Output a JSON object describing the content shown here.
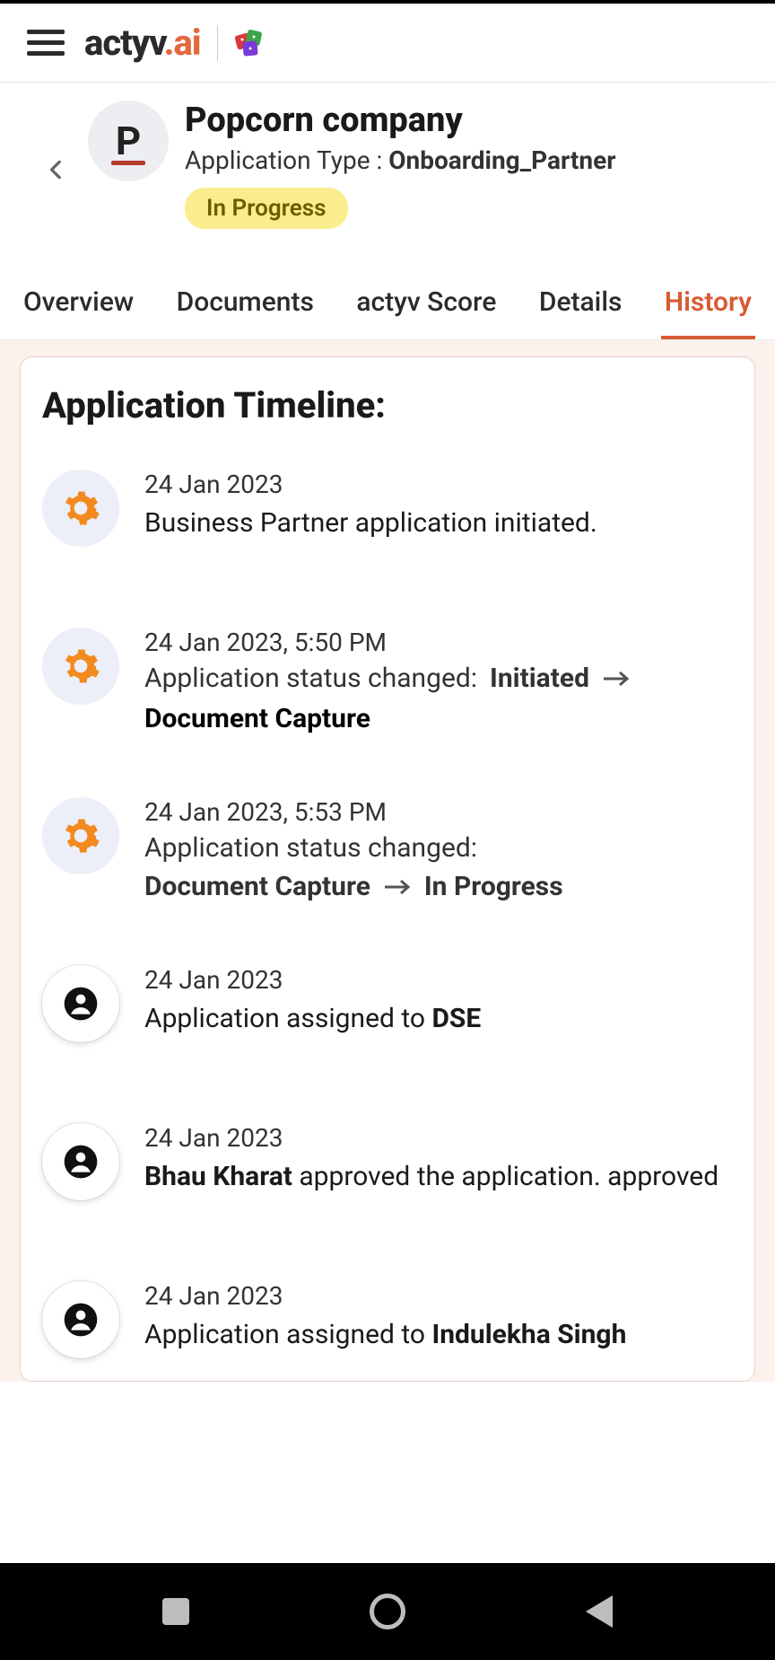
{
  "brand": {
    "name_part1": "actyv",
    "dot": ".",
    "name_part2": "ai"
  },
  "company": {
    "avatar_letter": "P",
    "name": "Popcorn company",
    "apptype_label": "Application Type : ",
    "apptype_value": "Onboarding_Partner",
    "status": "In Progress"
  },
  "tabs": {
    "overview": "Overview",
    "documents": "Documents",
    "score": "actyv Score",
    "details": "Details",
    "history": "History"
  },
  "timeline": {
    "heading": "Application Timeline:",
    "items": [
      {
        "icon": "gear",
        "date": "24 Jan 2023",
        "plain": "Business Partner application initiated."
      },
      {
        "icon": "gear",
        "date": "24 Jan 2023, 5:50 PM",
        "status_label": "Application status changed:",
        "from": "Initiated",
        "to": "Document Capture"
      },
      {
        "icon": "gear",
        "date": "24 Jan 2023, 5:53 PM",
        "status_label": "Application status changed:",
        "from": "Document Capture",
        "to": "In Progress"
      },
      {
        "icon": "person",
        "date": "24 Jan 2023",
        "prefix": "Application assigned to ",
        "bold": "DSE"
      },
      {
        "icon": "person",
        "date": "24 Jan 2023",
        "bold_first": "Bhau Kharat",
        "suffix": " approved the application. approved"
      },
      {
        "icon": "person",
        "date": "24 Jan 2023",
        "prefix": "Application assigned to ",
        "bold": "Indulekha Singh"
      }
    ]
  }
}
